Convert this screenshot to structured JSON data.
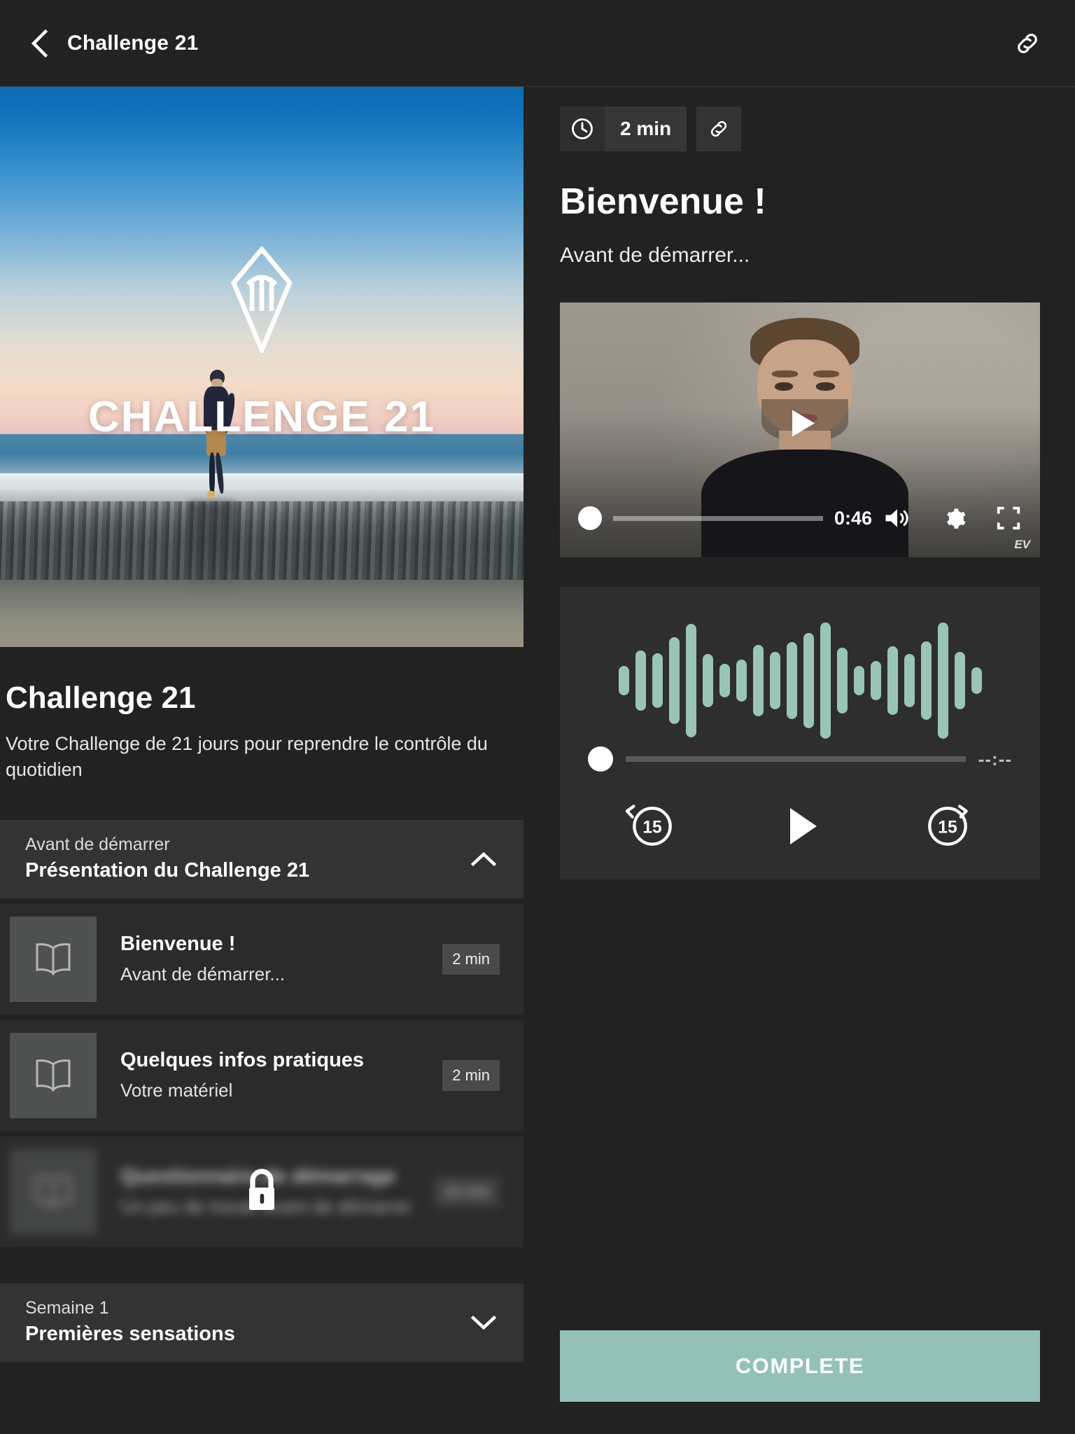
{
  "topbar": {
    "title": "Challenge 21",
    "back_icon": "chevron-left-icon",
    "link_icon": "link-icon"
  },
  "hero": {
    "logo_alt": "challenge-logo",
    "overlay_text": "CHALLENGE 21"
  },
  "course": {
    "title": "Challenge 21",
    "description": "Votre Challenge de 21 jours pour reprendre le contrôle du quotidien"
  },
  "sections": [
    {
      "kicker": "Avant de démarrer",
      "name": "Présentation du Challenge 21",
      "expanded": true,
      "chevron": "chevron-up-icon",
      "lessons": [
        {
          "title": "Bienvenue !",
          "subtitle": "Avant de démarrer...",
          "duration": "2 min",
          "icon": "book-icon",
          "locked": false
        },
        {
          "title": "Quelques infos pratiques",
          "subtitle": "Votre matériel",
          "duration": "2 min",
          "icon": "book-icon",
          "locked": false
        },
        {
          "title": "Questionnaire de démarrage",
          "subtitle": "Un peu de travail avant de démarrer",
          "duration": "10 min",
          "icon": "book-icon",
          "locked": true,
          "lock_icon": "lock-icon"
        }
      ]
    },
    {
      "kicker": "Semaine 1",
      "name": "Premières sensations",
      "expanded": false,
      "chevron": "chevron-down-icon",
      "lessons": []
    }
  ],
  "detail": {
    "duration": "2 min",
    "duration_icon": "clock-icon",
    "link_icon": "link-icon",
    "heading": "Bienvenue !",
    "kicker": "Avant de démarrer...",
    "video": {
      "time": "0:46",
      "play_icon": "play-icon",
      "volume_icon": "volume-icon",
      "settings_icon": "gear-icon",
      "fullscreen_icon": "fullscreen-icon",
      "watermark": "EV",
      "progress_percent": 0
    },
    "audio": {
      "time": "--:--",
      "progress_percent": 0,
      "rewind_label": "15",
      "forward_label": "15",
      "rewind_icon": "rewind-15-icon",
      "play_icon": "play-icon",
      "forward_icon": "forward-15-icon",
      "waveform": [
        22,
        46,
        42,
        66,
        86,
        40,
        26,
        32,
        54,
        44,
        58,
        72,
        88,
        50,
        22,
        30,
        52,
        40,
        60,
        88,
        44,
        20
      ],
      "wave_color": "#9bc4b8"
    },
    "complete_label": "COMPLETE"
  },
  "colors": {
    "accent": "#93c1b7",
    "background": "#222222",
    "panel": "#2e2e2e",
    "section_header": "#333333",
    "lesson_row": "#2b2b2b"
  }
}
